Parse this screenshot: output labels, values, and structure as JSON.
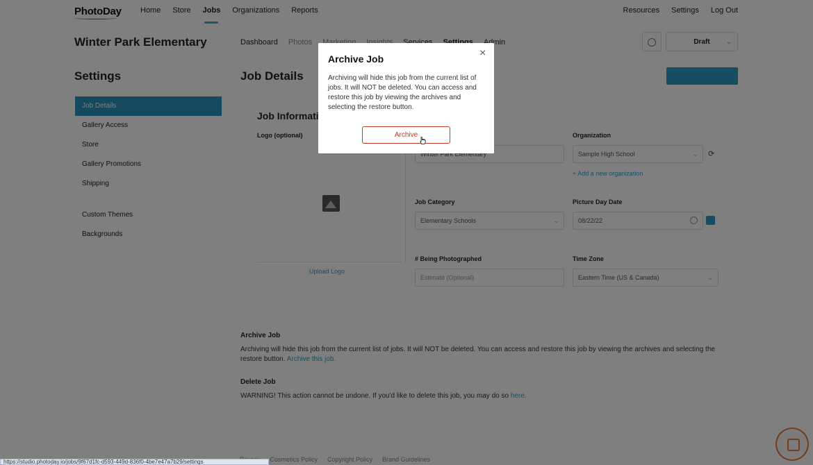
{
  "app": {
    "logo": "PhotoDay"
  },
  "nav": {
    "left": [
      "Home",
      "Store",
      "Jobs",
      "Organizations",
      "Reports"
    ],
    "right": [
      "Resources",
      "Settings",
      "Log Out"
    ]
  },
  "job": {
    "title": "Winter Park Elementary",
    "tabs": [
      "Dashboard",
      "Photos",
      "Marketing",
      "Insights",
      "Services",
      "Settings",
      "Admin"
    ],
    "status": "Draft"
  },
  "sidebar": {
    "title": "Settings",
    "items": [
      "Job Details",
      "Gallery Access",
      "Store",
      "Gallery Promotions",
      "Shipping"
    ],
    "items2": [
      "Custom Themes",
      "Backgrounds"
    ]
  },
  "main": {
    "title": "Job Details",
    "card_title": "Job Information",
    "logo_label": "Logo (optional)",
    "upload_link": "Upload Logo",
    "org_label": "Organization",
    "org_value": "Sample High School",
    "add_org": "+ Add a new organization",
    "job_name_value": "Winter Park Elementary",
    "category_label": "Job Category",
    "category_value": "Elementary Schools",
    "date_label": "Picture Day Date",
    "date_value": "08/22/22",
    "photographed_label": "# Being Photographed",
    "photographed_placeholder": "Estimate (Optional)",
    "timezone_label": "Time Zone",
    "timezone_value": "Eastern Time (US & Canada)"
  },
  "archive_section": {
    "heading": "Archive Job",
    "text": "Archiving will hide this job from the current list of jobs. It will NOT be deleted. You can access and restore this job by viewing the archives and selecting the restore button.",
    "link": "Archive this job."
  },
  "delete_section": {
    "heading": "Delete Job",
    "warning": "WARNING!",
    "text": "This action cannot be undone. If you'd like to delete this job, you may do so",
    "link": "here."
  },
  "footer": [
    "Privacy",
    "Cosmetics Policy",
    "Copyright Policy",
    "Brand Guidelines"
  ],
  "statusbar_url": "https://studio.photoday.io/jobs/9f67d1fc-d593-449d-836f0-4be7e47a7b29/settings",
  "modal": {
    "title": "Archive Job",
    "body": "Archiving will hide this job from the current list of jobs. It will NOT be deleted. You can access and restore this job by viewing the archives and selecting the restore button.",
    "button": "Archive",
    "close": "×"
  },
  "colors": {
    "accent": "#2f9bc4",
    "danger": "#c0392b",
    "overlay": "rgba(0,0,0,0.5)"
  }
}
